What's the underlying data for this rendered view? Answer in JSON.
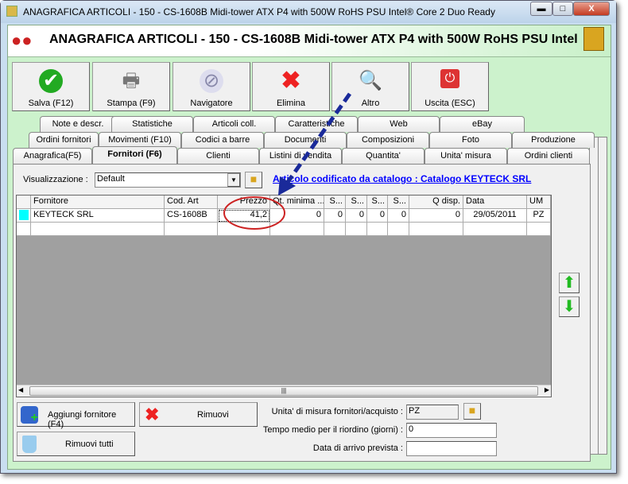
{
  "window": {
    "title": "ANAGRAFICA ARTICOLI - 150 - CS-1608B Midi-tower ATX P4 with 500W RoHS PSU Intel® Core 2 Duo Ready",
    "minimize": "▬",
    "maximize": "□",
    "close": "X"
  },
  "header": {
    "title": "ANAGRAFICA ARTICOLI - 150 - CS-1608B Midi-tower ATX P4 with 500W RoHS PSU Intel"
  },
  "toolbar": [
    {
      "label": "Salva (F12)",
      "icon": "check-icon"
    },
    {
      "label": "Stampa (F9)",
      "icon": "printer-icon"
    },
    {
      "label": "Navigatore",
      "icon": "compass-icon"
    },
    {
      "label": "Elimina",
      "icon": "x-icon"
    },
    {
      "label": "Altro",
      "icon": "magnifier-book-icon"
    },
    {
      "label": "Uscita (ESC)",
      "icon": "power-icon"
    }
  ],
  "tabs": {
    "row1": [
      "Note e descr.",
      "Statistiche",
      "Articoli coll.",
      "Caratteristiche",
      "Web",
      "eBay"
    ],
    "row2": [
      "Ordini fornitori",
      "Movimenti (F10)",
      "Codici a barre",
      "Documenti",
      "Composizioni",
      "Foto",
      "Produzione"
    ],
    "row3": [
      "Anagrafica(F5)",
      "Fornitori (F6)",
      "Clienti",
      "Listini di vendita",
      "Quantita'",
      "Unita' misura",
      "Ordini clienti"
    ],
    "active": "Fornitori (F6)"
  },
  "view": {
    "label": "Visualizzazione :",
    "value": "Default",
    "link": "Articolo codificato da catalogo : Catalogo KEYTECK SRL"
  },
  "grid": {
    "columns": [
      "Fornitore",
      "Cod. Art",
      "Prezzo",
      "Qt. minima ...",
      "S...",
      "S...",
      "S...",
      "S...",
      "Q disp.",
      "Data",
      "UM"
    ],
    "rows": [
      [
        "KEYTECK SRL",
        "CS-1608B",
        "41,2",
        "0",
        "0",
        "0",
        "0",
        "0",
        "0",
        "29/05/2011",
        "PZ"
      ]
    ]
  },
  "buttons": {
    "add": "Aggiungi fornitore (F4)",
    "remove": "Rimuovi",
    "remove_all": "Rimuovi tutti"
  },
  "fields": {
    "um_label": "Unita' di misura fornitori/acquisto :",
    "um_value": "PZ",
    "tempo_label": "Tempo medio per il riordino (giorni) :",
    "tempo_value": "0",
    "data_label": "Data di arrivo prevista :",
    "data_value": ""
  },
  "colors": {
    "accent_green": "#ccf2cc",
    "link": "#0000ff",
    "annotation_arrow": "#1a2a9a",
    "annotation_circle": "#cc2222"
  }
}
